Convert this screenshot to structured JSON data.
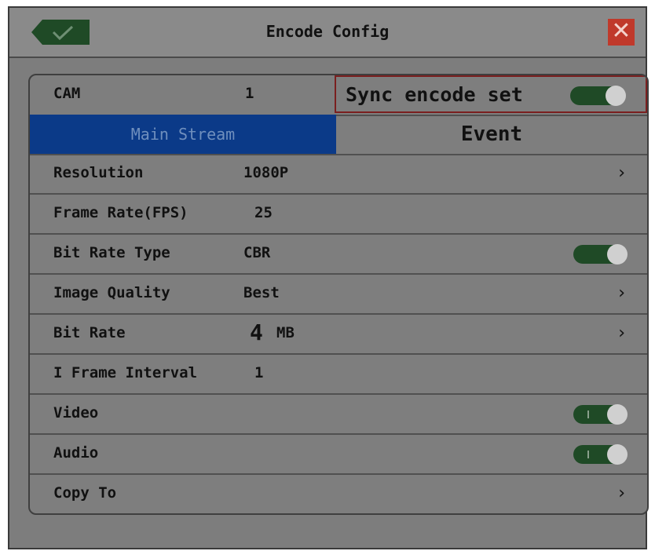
{
  "window": {
    "title": "Encode Config",
    "close_glyph": "✕"
  },
  "top": {
    "cam_label": "CAM",
    "cam_value": "1",
    "sync_label": "Sync encode set",
    "sync_on": true
  },
  "tabs": [
    {
      "label": "Main Stream",
      "active": true
    },
    {
      "label": "Event",
      "active": false
    }
  ],
  "rows": [
    {
      "label": "Resolution",
      "value": "1080P",
      "control": "chevron"
    },
    {
      "label": "Frame Rate(FPS)",
      "value": "25",
      "control": "none"
    },
    {
      "label": "Bit Rate Type",
      "value": "CBR",
      "control": "toggle"
    },
    {
      "label": "Image Quality",
      "value": "Best",
      "control": "chevron"
    },
    {
      "label": "Bit Rate",
      "value_big": "4",
      "value_unit": "MB",
      "control": "chevron"
    },
    {
      "label": "I Frame Interval",
      "value": "1",
      "control": "none"
    },
    {
      "label": "Video",
      "value": "",
      "control": "toggle"
    },
    {
      "label": "Audio",
      "value": "",
      "control": "toggle"
    },
    {
      "label": "Copy To",
      "value": "",
      "control": "chevron"
    }
  ],
  "icons": {
    "ok": "checkmark-icon",
    "close": "close-icon",
    "chevron": "chevron-right-icon"
  },
  "colors": {
    "tab_active": "#0b3a88",
    "toggle_on": "#1f4a26",
    "close_bg": "#c0392b",
    "sync_border": "#7a1f1f"
  }
}
